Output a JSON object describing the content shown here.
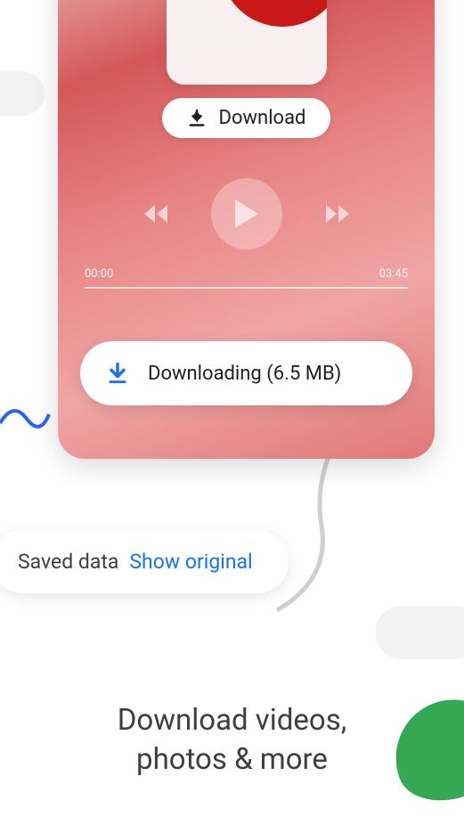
{
  "player": {
    "download_label": "Download",
    "time_current": "00:00",
    "time_total": "03:45",
    "downloading_label": "Downloading (6.5 MB)"
  },
  "data_saver": {
    "saved_label": "Saved data",
    "show_original_label": "Show original"
  },
  "headline": {
    "line1": "Download videos,",
    "line2": "photos & more"
  },
  "colors": {
    "blue": "#1a73e8",
    "green": "#34a853",
    "text": "#3c4043"
  }
}
